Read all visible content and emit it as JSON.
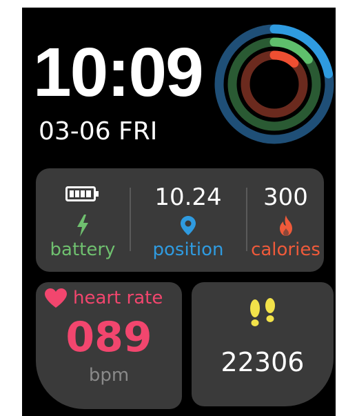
{
  "time": "10:09",
  "date": "03-06 FRI",
  "rings": {
    "move_color": "#2f9be0",
    "exercise_color": "#5fbf6c",
    "stand_color": "#ef4f32",
    "move_progress": 0.22,
    "exercise_progress": 0.15,
    "stand_progress": 0.12
  },
  "stats": {
    "battery": {
      "label": "battery",
      "color": "#6fc06f",
      "icon": "battery-full-icon",
      "bolt_icon": "lightning-bolt-icon"
    },
    "position": {
      "value": "10.24",
      "label": "position",
      "color": "#2f9be0",
      "icon": "location-pin-icon"
    },
    "calories": {
      "value": "300",
      "label": "calories",
      "color": "#ef5a3a",
      "icon": "flame-icon"
    }
  },
  "heart_rate": {
    "label": "heart rate",
    "value": "089",
    "unit": "bpm",
    "color": "#f2466e",
    "icon": "heart-icon"
  },
  "steps": {
    "value": "22306",
    "icon": "footprints-icon",
    "icon_color": "#f2e24a"
  }
}
